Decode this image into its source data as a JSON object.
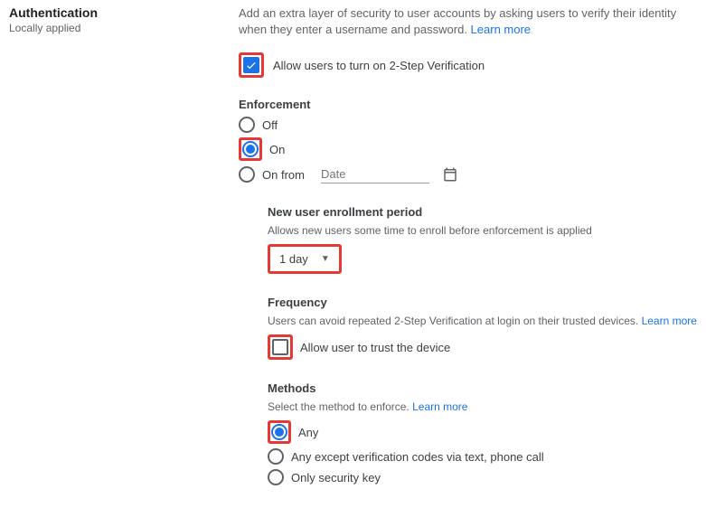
{
  "left": {
    "title": "Authentication",
    "subtitle": "Locally applied"
  },
  "desc": {
    "text": "Add an extra layer of security to user accounts by asking users to verify their identity when they enter a username and password. ",
    "learn_more": "Learn more"
  },
  "allow_2sv": {
    "label": "Allow users to turn on 2-Step Verification"
  },
  "enforcement": {
    "title": "Enforcement",
    "off": "Off",
    "on": "On",
    "on_from": "On from",
    "date_placeholder": "Date"
  },
  "enrollment": {
    "title": "New user enrollment period",
    "sub": "Allows new users some time to enroll before enforcement is applied",
    "value": "1 day"
  },
  "frequency": {
    "title": "Frequency",
    "sub": "Users can avoid repeated 2-Step Verification at login on their trusted devices. ",
    "learn_more": "Learn more",
    "trust_label": "Allow user to trust the device"
  },
  "methods": {
    "title": "Methods",
    "sub": "Select the method to enforce. ",
    "learn_more": "Learn more",
    "any": "Any",
    "except": "Any except verification codes via text, phone call",
    "only_key": "Only security key"
  }
}
